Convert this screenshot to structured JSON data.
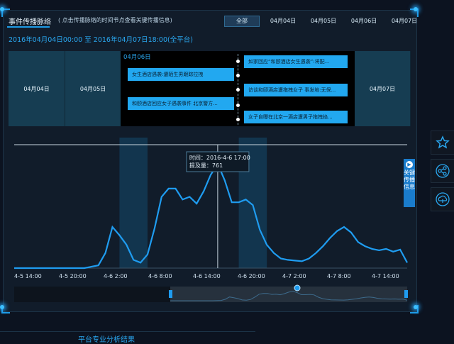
{
  "header": {
    "title": "事件传播脉络",
    "hint": "( 点击传播脉络的时间节点查看关键传播信息)",
    "tabs": [
      {
        "label": "全部",
        "active": true
      },
      {
        "label": "04月04日",
        "active": false
      },
      {
        "label": "04月05日",
        "active": false
      },
      {
        "label": "04月06日",
        "active": false
      },
      {
        "label": "04月07日",
        "active": false
      }
    ]
  },
  "range_text": "2016年04月04日00:00 至 2016年04月07日18:00(全平台)",
  "timeline": {
    "days": [
      "04月04日",
      "04月05日",
      "04月07日"
    ],
    "expanded_day": "04月06日",
    "left_events": [
      "女生酒店遇袭:遭陌生男跟踪拉拽",
      "和颐酒店回应女子遇袭事件 北京警方..."
    ],
    "right_events": [
      "如家回应“和颐酒店女生遇袭”:将配...",
      "访谈和颐酒店遭拖拽女子 事发地:无保...",
      "女子自曝在北京一酒店遭男子拖拽掐..."
    ]
  },
  "chart_data": {
    "type": "line",
    "x_tick_labels": [
      "4-5 14:00",
      "4-5 20:00",
      "4-6 2:00",
      "4-6 8:00",
      "4-6 14:00",
      "4-6 20:00",
      "4-7 2:00",
      "4-7 8:00",
      "4-7 14:00"
    ],
    "hours": [
      0,
      2,
      4,
      6,
      8,
      10,
      12,
      13,
      14,
      15,
      16,
      17,
      18,
      19,
      20,
      21,
      22,
      23,
      24,
      25,
      26,
      27,
      28,
      29,
      30,
      31,
      32,
      33,
      34,
      35,
      36,
      37,
      38,
      39,
      40,
      41,
      42,
      43,
      44,
      45,
      46,
      47,
      48,
      49,
      50,
      51,
      52,
      53,
      54,
      55,
      56
    ],
    "values": [
      0,
      0,
      0,
      0,
      0,
      0,
      20,
      110,
      300,
      240,
      170,
      60,
      40,
      100,
      290,
      520,
      580,
      580,
      500,
      520,
      470,
      560,
      680,
      761,
      640,
      480,
      480,
      500,
      460,
      280,
      170,
      110,
      70,
      60,
      55,
      50,
      70,
      110,
      160,
      220,
      270,
      300,
      260,
      190,
      160,
      140,
      130,
      140,
      120,
      135,
      40
    ],
    "highlight_bands": [
      [
        15,
        19
      ],
      [
        32,
        36
      ]
    ],
    "tooltip": {
      "time_label": "时间：2016-4-6 17:00",
      "volume_label": "提及量：761"
    },
    "ylim": [
      0,
      900
    ]
  },
  "side_tab_label": "关键传播信息",
  "side_icons": [
    "star-icon",
    "share-icon",
    "cloud-icon"
  ],
  "footer_text": "平台专业分析结果"
}
